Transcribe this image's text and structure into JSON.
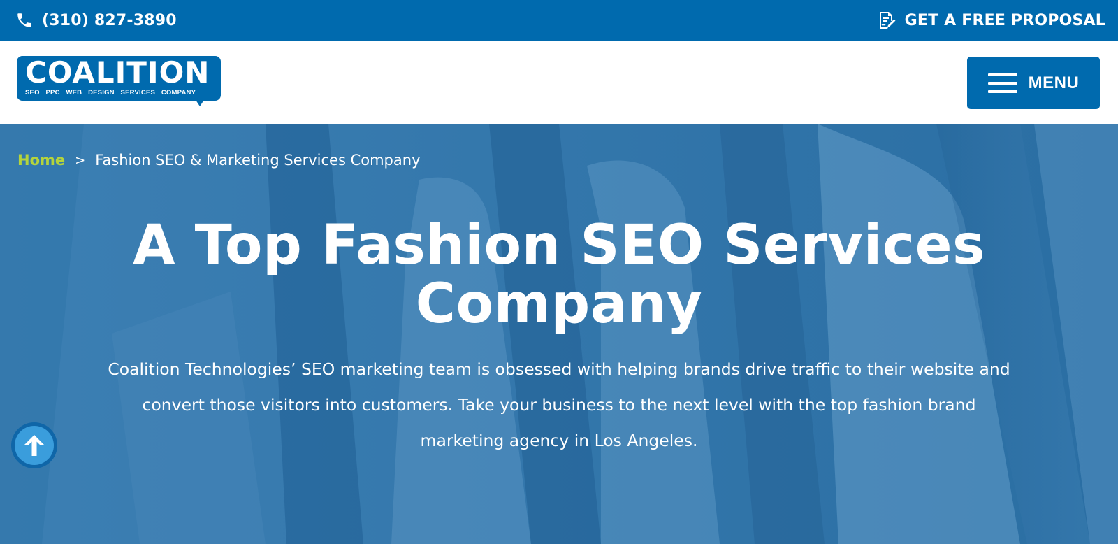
{
  "topbar": {
    "phone": "(310) 827-3890",
    "proposal_label": "GET A FREE PROPOSAL"
  },
  "header": {
    "logo": {
      "wordmark": "COALITION",
      "tagline": "SEO PPC WEB DESIGN SERVICES COMPANY"
    },
    "menu_label": "MENU"
  },
  "hero": {
    "breadcrumb": {
      "home": "Home",
      "separator": ">",
      "current": "Fashion SEO & Marketing Services Company"
    },
    "title": "A Top Fashion SEO Services Company",
    "description": "Coalition Technologies’ SEO marketing team is obsessed with helping brands drive traffic to their website and convert those visitors into customers. Take your business to the next level with the top fashion brand marketing agency in Los Angeles."
  },
  "icons": {
    "phone": "phone-icon",
    "proposal": "proposal-document-icon",
    "menu": "hamburger-icon",
    "scroll_top": "arrow-up-icon"
  },
  "colors": {
    "brand_blue": "#006aae",
    "hero_overlay": "#2c74a8",
    "breadcrumb_home": "#b5d43c",
    "text_white": "#ffffff"
  }
}
